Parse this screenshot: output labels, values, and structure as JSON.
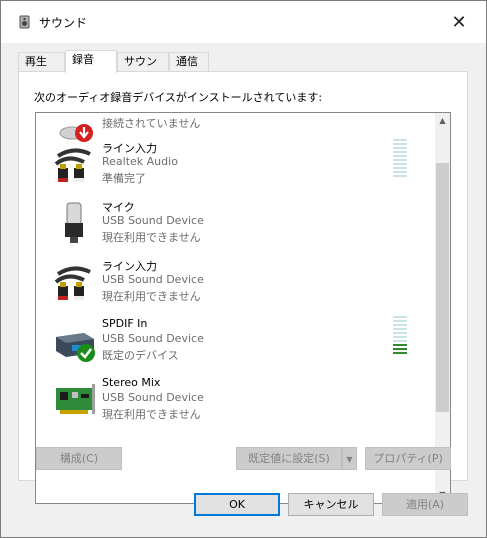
{
  "window": {
    "title": "サウンド"
  },
  "tabs": [
    {
      "label": "再生"
    },
    {
      "label": "録音"
    },
    {
      "label": "サウンド"
    },
    {
      "label": "通信"
    }
  ],
  "panel": {
    "instruction": "次のオーディオ録音デバイスがインストールされています:"
  },
  "devices": [
    {
      "name": "",
      "line1": "接続されていません",
      "line2": ""
    },
    {
      "name": "ライン入力",
      "line1": "Realtek Audio",
      "line2": "準備完了"
    },
    {
      "name": "マイク",
      "line1": "USB Sound Device",
      "line2": "現在利用できません"
    },
    {
      "name": "ライン入力",
      "line1": "USB Sound Device",
      "line2": "現在利用できません"
    },
    {
      "name": "SPDIF In",
      "line1": "USB Sound Device",
      "line2": "既定のデバイス"
    },
    {
      "name": "Stereo Mix",
      "line1": "USB Sound Device",
      "line2": "現在利用できません"
    }
  ],
  "level_meters": {
    "realtek_line_in": 0,
    "spdif_in": 0.3
  },
  "buttons": {
    "configure": "構成(C)",
    "set_default": "既定値に設定(S)",
    "properties": "プロパティ(P)",
    "ok": "OK",
    "cancel": "キャンセル",
    "apply": "適用(A)"
  },
  "colors": {
    "accent": "#0078d7",
    "meter_on": "#2e8b2e",
    "meter_off": "#c8e3e3",
    "check_green": "#1a8c1a",
    "unplugged_red": "#d42020"
  }
}
